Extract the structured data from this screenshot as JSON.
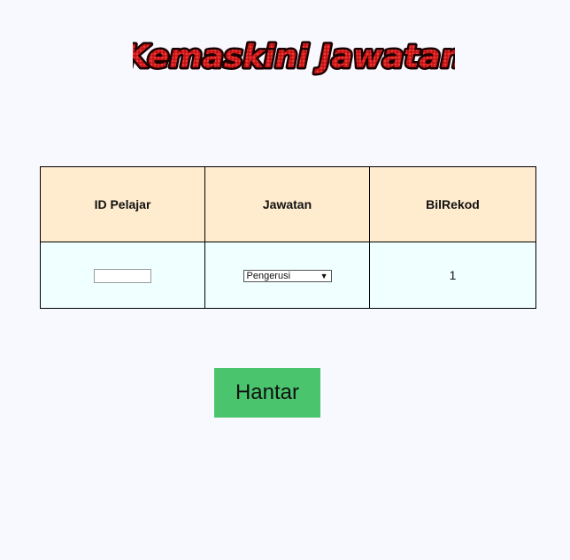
{
  "banner": {
    "title": "Kemaskini Jawatan",
    "fill_color": "#d41a1a",
    "outline_color": "#1a0000"
  },
  "table": {
    "headers": [
      "ID Pelajar",
      "Jawatan",
      "BilRekod"
    ],
    "row": {
      "id_pelajar_value": "",
      "jawatan_selected": "Pengerusi",
      "bilrekod": "1"
    }
  },
  "form": {
    "submit_label": "Hantar"
  },
  "colors": {
    "page_bg": "#f8f8ff",
    "header_bg": "#ffebcd",
    "row_bg": "#f0ffff",
    "button_bg": "#4ac56e"
  }
}
